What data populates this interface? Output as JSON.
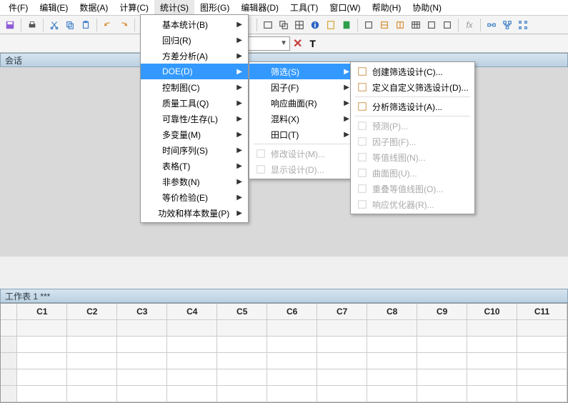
{
  "menubar": [
    "件(F)",
    "编辑(E)",
    "数据(A)",
    "计算(C)",
    "统计(S)",
    "图形(G)",
    "编辑器(D)",
    "工具(T)",
    "窗口(W)",
    "帮助(H)",
    "协助(N)"
  ],
  "session_label": "会话",
  "menu_stats": [
    {
      "label": "基本统计(B)",
      "arrow": true
    },
    {
      "label": "回归(R)",
      "arrow": true
    },
    {
      "label": "方差分析(A)",
      "arrow": true
    },
    {
      "label": "DOE(D)",
      "arrow": true,
      "hl": true
    },
    {
      "label": "控制图(C)",
      "arrow": true
    },
    {
      "label": "质量工具(Q)",
      "arrow": true
    },
    {
      "label": "可靠性/生存(L)",
      "arrow": true
    },
    {
      "label": "多变量(M)",
      "arrow": true
    },
    {
      "label": "时间序列(S)",
      "arrow": true
    },
    {
      "label": "表格(T)",
      "arrow": true
    },
    {
      "label": "非参数(N)",
      "arrow": true
    },
    {
      "label": "等价检验(E)",
      "arrow": true
    },
    {
      "label": "功效和样本数量(P)",
      "arrow": true
    }
  ],
  "menu_doe": [
    {
      "label": "筛选(S)",
      "arrow": true,
      "hl": true
    },
    {
      "label": "因子(F)",
      "arrow": true
    },
    {
      "label": "响应曲面(R)",
      "arrow": true
    },
    {
      "label": "混料(X)",
      "arrow": true
    },
    {
      "label": "田口(T)",
      "arrow": true
    },
    {
      "divider": true
    },
    {
      "label": "修改设计(M)...",
      "dis": true,
      "icon": "modify"
    },
    {
      "label": "显示设计(D)...",
      "dis": true,
      "icon": "display"
    }
  ],
  "menu_screen": [
    {
      "label": "创建筛选设计(C)...",
      "icon": "create"
    },
    {
      "label": "定义自定义筛选设计(D)...",
      "icon": "define"
    },
    {
      "divider": true
    },
    {
      "label": "分析筛选设计(A)...",
      "icon": "analyze"
    },
    {
      "divider": true
    },
    {
      "label": "预测(P)...",
      "dis": true,
      "icon": "predict"
    },
    {
      "label": "因子图(F)...",
      "dis": true,
      "icon": "factor"
    },
    {
      "label": "等值线图(N)...",
      "dis": true,
      "icon": "contour"
    },
    {
      "label": "曲面图(U)...",
      "dis": true,
      "icon": "surface"
    },
    {
      "label": "重叠等值线图(O)...",
      "dis": true,
      "icon": "overlay"
    },
    {
      "label": "响应优化器(R)...",
      "dis": true,
      "icon": "optimize"
    }
  ],
  "sheet_title": "工作表 1 ***",
  "columns": [
    "C1",
    "C2",
    "C3",
    "C4",
    "C5",
    "C6",
    "C7",
    "C8",
    "C9",
    "C10",
    "C11"
  ]
}
